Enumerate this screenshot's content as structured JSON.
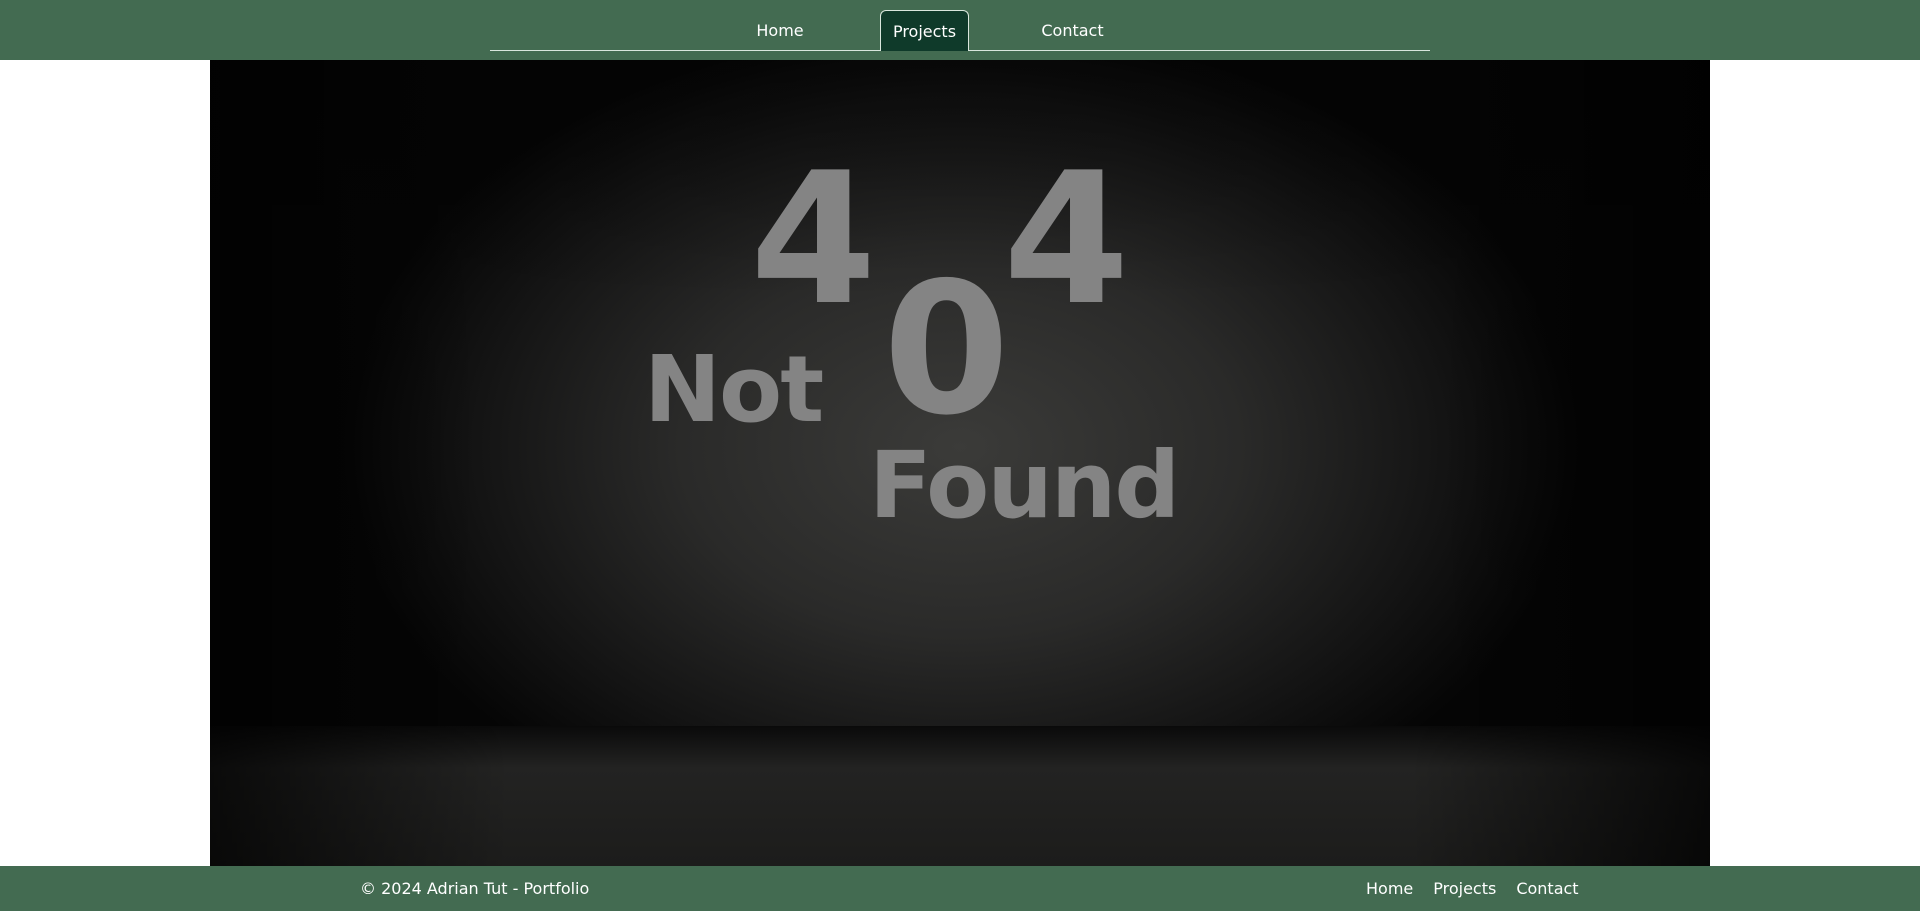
{
  "header": {
    "nav": {
      "home_label": "Home",
      "projects_label": "Projects",
      "contact_label": "Contact",
      "active": "Projects"
    }
  },
  "hero": {
    "digit_left": "4",
    "digit_middle": "0",
    "digit_right": "4",
    "word_not": "Not",
    "word_found": "Found"
  },
  "footer": {
    "copyright": "© 2024 Adrian Tut - Portfolio",
    "nav": {
      "home_label": "Home",
      "projects_label": "Projects",
      "contact_label": "Contact"
    }
  },
  "colors": {
    "brand_green": "#436b51",
    "active_tab": "#0f3a2a",
    "glyph_gray": "#848484"
  }
}
